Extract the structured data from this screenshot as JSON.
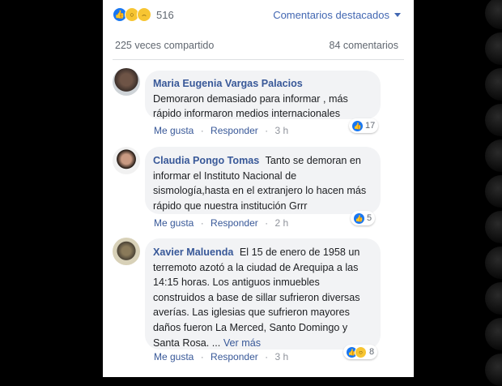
{
  "post_stats": {
    "reaction_icons": [
      "like-icon",
      "wow-icon",
      "sad-icon"
    ],
    "reaction_count": "516",
    "featured_label": "Comentarios destacados",
    "shares_text": "225 veces compartido",
    "comments_text": "84 comentarios"
  },
  "comments": [
    {
      "author": "Maria Eugenia Vargas Palacios",
      "text": "Demoraron demasiado para informar , más rápido informaron medios internacionales",
      "like_label": "Me gusta",
      "reply_label": "Responder",
      "separator": "·",
      "time": "3 h",
      "reaction_count": "17",
      "reaction_icons": [
        "like-icon"
      ]
    },
    {
      "author": "Claudia Pongo Tomas",
      "text": "Tanto se demoran en informar el Instituto Nacional de sismología,hasta en el extranjero lo hacen más rápido que nuestra institución Grrr",
      "like_label": "Me gusta",
      "reply_label": "Responder",
      "separator": "·",
      "time": "2 h",
      "reaction_count": "5",
      "reaction_icons": [
        "like-icon"
      ]
    },
    {
      "author": "Xavier Maluenda",
      "text": "El 15 de enero de 1958 un terremoto azotó a la ciudad de Arequipa a las 14:15 horas. Los antiguos inmuebles construidos a base de sillar sufrieron diversas averías. Las iglesias que sufrieron mayores daños fueron La Merced, Santo Domingo y Santa Rosa. ...",
      "see_more": "Ver más",
      "like_label": "Me gusta",
      "reply_label": "Responder",
      "separator": "·",
      "time": "3 h",
      "reaction_count": "8",
      "reaction_icons": [
        "like-icon",
        "wow-icon"
      ]
    }
  ]
}
